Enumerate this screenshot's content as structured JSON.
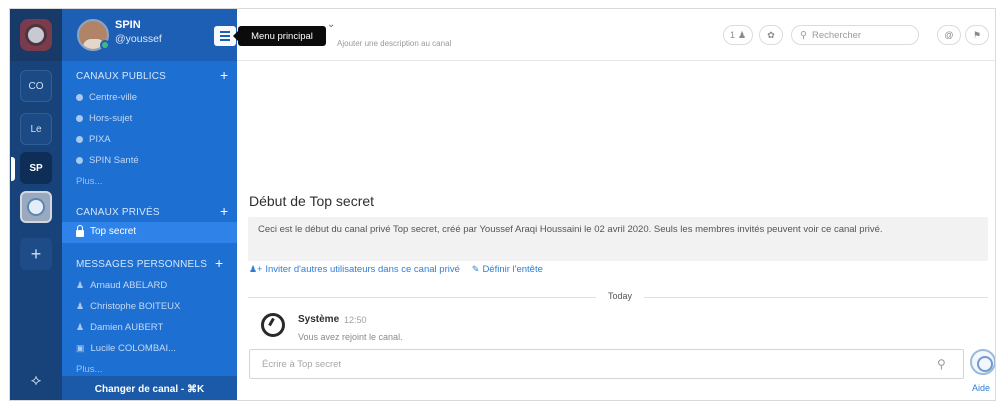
{
  "team_rail": {
    "teams": [
      {
        "label": "CO"
      },
      {
        "label": "Le"
      },
      {
        "label": "SP",
        "active": true
      }
    ]
  },
  "sidebar": {
    "team_name": "SPIN",
    "username": "@youssef",
    "menu_tooltip": "Menu principal",
    "public_channels": {
      "title": "CANAUX PUBLICS",
      "items": [
        "Centre-ville",
        "Hors-sujet",
        "PIXA",
        "SPIN Santé"
      ],
      "more": "Plus..."
    },
    "private_channels": {
      "title": "CANAUX PRIVÉS",
      "items": [
        "Top secret"
      ]
    },
    "direct_messages": {
      "title": "MESSAGES PERSONNELS",
      "items": [
        "Arnaud ABELARD",
        "Christophe BOITEUX",
        "Damien AUBERT",
        "Lucile COLOMBAI..."
      ],
      "more": "Plus..."
    },
    "switcher": "Changer de canal - ⌘K"
  },
  "header": {
    "channel_description": "Ajouter une description au canal",
    "members_count": "1",
    "search_placeholder": "Rechercher"
  },
  "main": {
    "intro_title": "Début de Top secret",
    "intro_text": "Ceci est le début du canal privé Top secret, créé par Youssef Araqi Houssaini le 02 avril 2020. Seuls les membres invités peuvent voir ce canal privé.",
    "invite_action": "Inviter d'autres utilisateurs dans ce canal privé",
    "header_action": "Définir l'entête",
    "date_separator": "Today",
    "message": {
      "author": "Système",
      "time": "12:50",
      "text": "Vous avez rejoint le canal."
    },
    "composer_placeholder": "Écrire à Top secret",
    "help": "Aide"
  },
  "colors": {
    "rail": "#18437a",
    "sidebar": "#1e6fd2",
    "accent_link": "#2f7ed6",
    "status_online": "#3db887"
  }
}
